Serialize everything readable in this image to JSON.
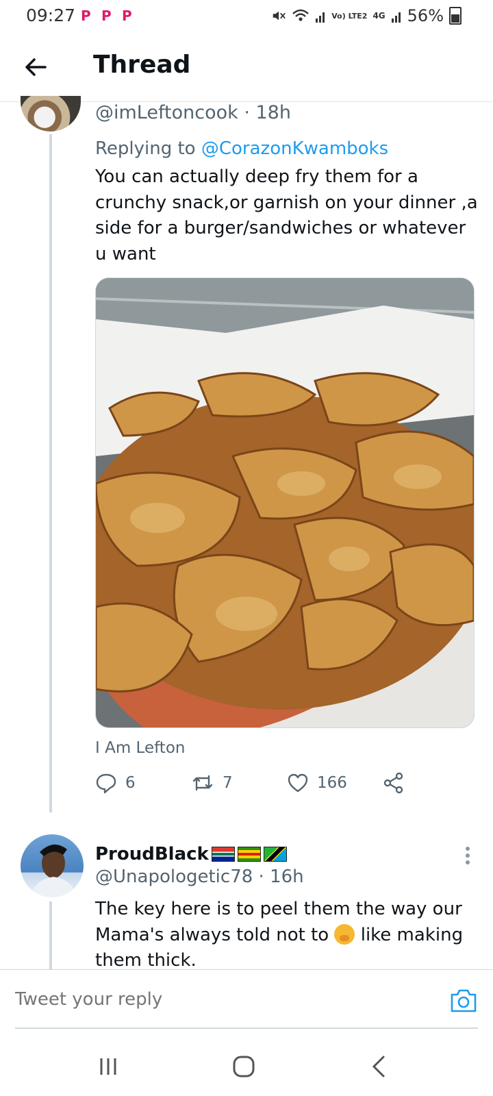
{
  "status_bar": {
    "time": "09:27",
    "battery": "56%",
    "network_small": "Vo) LTE2",
    "network_gen": "4G"
  },
  "header": {
    "title": "Thread"
  },
  "tweet1": {
    "handle": "@imLeftoncook",
    "separator": " · ",
    "time": "18h",
    "replying_prefix": "Replying to ",
    "replying_to": "@CorazonKwamboks",
    "text": "You can actually deep fry them for a crunchy snack,or garnish on your dinner ,a side for a burger/sandwiches or whatever u want",
    "media_caption": "I Am Lefton",
    "replies": "6",
    "retweets": "7",
    "likes": "166"
  },
  "tweet2": {
    "name": "ProudBlack",
    "handle": "@Unapologetic78",
    "separator": " · ",
    "time": "16h",
    "text_before_emoji": "The key here is to peel them the way our Mama's always told not to ",
    "text_after_emoji": " like making them thick."
  },
  "reply_bar": {
    "placeholder": "Tweet your reply"
  },
  "colors": {
    "accent": "#1d9bf0",
    "secondary_text": "#536471",
    "thread_line": "#cfd9de"
  }
}
